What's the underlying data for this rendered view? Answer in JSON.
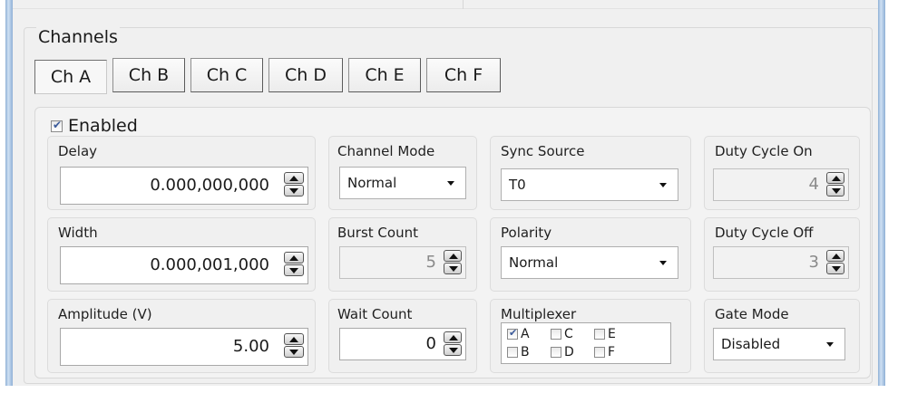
{
  "channels": {
    "title": "Channels",
    "tabs": [
      "Ch A",
      "Ch B",
      "Ch C",
      "Ch D",
      "Ch E",
      "Ch F"
    ],
    "active_tab": "Ch A"
  },
  "enabled": {
    "label": "Enabled",
    "checked": true
  },
  "delay": {
    "label": "Delay",
    "value": "0.000,000,000"
  },
  "width": {
    "label": "Width",
    "value": "0.000,001,000"
  },
  "amplitude": {
    "label": "Amplitude (V)",
    "value": "5.00"
  },
  "channel_mode": {
    "label": "Channel Mode",
    "value": "Normal"
  },
  "burst_count": {
    "label": "Burst Count",
    "value": "5"
  },
  "wait_count": {
    "label": "Wait Count",
    "value": "0"
  },
  "sync_source": {
    "label": "Sync Source",
    "value": "T0"
  },
  "polarity": {
    "label": "Polarity",
    "value": "Normal"
  },
  "multiplexer": {
    "label": "Multiplexer",
    "items": [
      {
        "name": "A",
        "checked": true
      },
      {
        "name": "C",
        "checked": false
      },
      {
        "name": "E",
        "checked": false
      },
      {
        "name": "B",
        "checked": false
      },
      {
        "name": "D",
        "checked": false
      },
      {
        "name": "F",
        "checked": false
      }
    ]
  },
  "duty_cycle_on": {
    "label": "Duty Cycle On",
    "value": "4"
  },
  "duty_cycle_off": {
    "label": "Duty Cycle Off",
    "value": "3"
  },
  "gate_mode": {
    "label": "Gate Mode",
    "value": "Disabled"
  }
}
